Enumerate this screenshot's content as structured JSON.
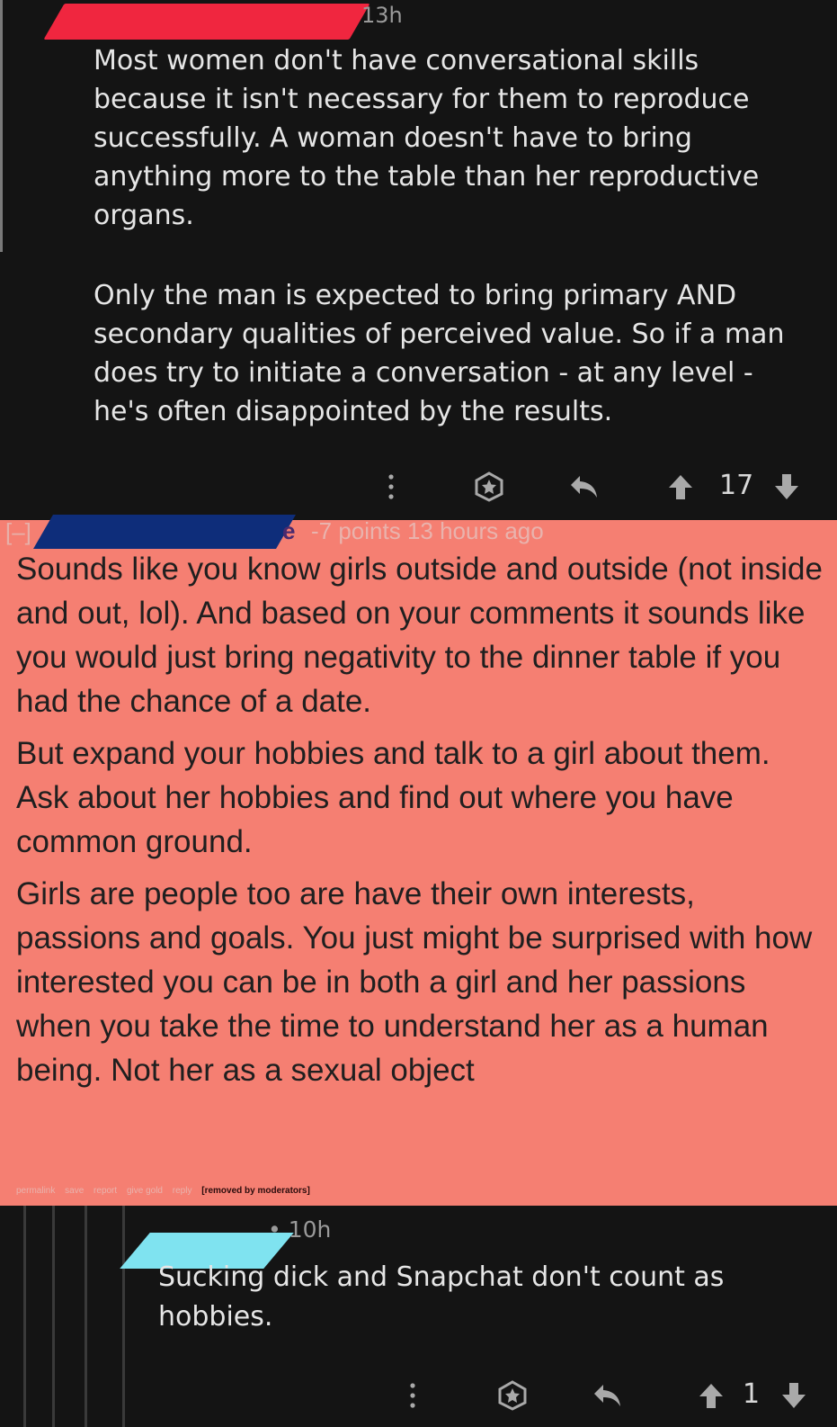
{
  "comment1": {
    "time": "13h",
    "paragraphs": [
      "Most women don't have conversational skills because it isn't necessary for them to reproduce successfully. A woman doesn't have to bring anything more to the table than her reproductive organs.",
      "Only the man is expected to bring primary AND secondary qualities of perceived value. So if a man does try to initiate a conversation - at any level - he's often disappointed by the results."
    ],
    "score": "17",
    "icons": [
      "more-icon",
      "award-icon",
      "reply-icon",
      "upvote-icon",
      "downvote-icon"
    ]
  },
  "comment2": {
    "collapse": "[–]",
    "author_tail": "e",
    "points": "-7 points 13 hours ago",
    "paragraphs": [
      "Sounds like you know girls outside and outside (not inside and out, lol). And based on your comments it sounds like you would just bring negativity to the dinner table if you had the chance of a date.",
      "But expand your hobbies and talk to a girl about them. Ask about her hobbies and find out where you have common ground.",
      "Girls are people too are have their own interests, passions and goals. You just might be surprised with how interested you can be in both a girl and her passions when you take the time to understand her as a human being. Not her as a sexual object"
    ],
    "links": {
      "permalink": "permalink",
      "save": "save",
      "report": "report",
      "give_gold": "give gold",
      "reply": "reply",
      "removed": "[removed by moderators]"
    },
    "background_color": "#f57f72"
  },
  "comment3": {
    "time": "• 10h",
    "body": "Sucking dick and Snapchat don't count as hobbies.",
    "score": "1"
  },
  "redaction_colors": {
    "comment1": "#f0263f",
    "comment2": "#0e2d7a",
    "comment3": "#7fe3f0"
  }
}
